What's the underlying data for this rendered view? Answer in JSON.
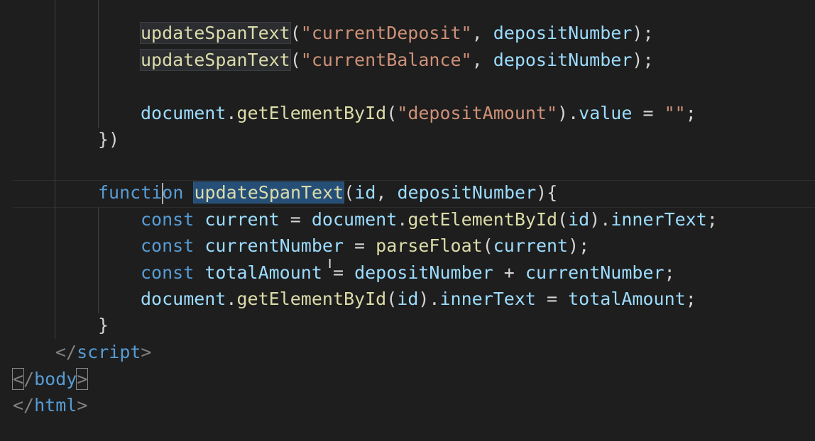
{
  "editor": {
    "theme": "dark",
    "background": "#1e1e1e",
    "colors": {
      "function": "#dcdcaa",
      "variable": "#9cdcfe",
      "string": "#ce9178",
      "keyword": "#569cd6",
      "punctuation": "#d4d4d4",
      "tag_bracket": "#808080"
    },
    "lines": [
      {
        "tokens": [
          {
            "t": "updateSpanText",
            "k": "fn hl"
          },
          {
            "t": "(",
            "k": "punc"
          },
          {
            "t": "\"currentDeposit\"",
            "k": "str"
          },
          {
            "t": ", ",
            "k": "punc"
          },
          {
            "t": "depositNumber",
            "k": "var"
          },
          {
            "t": ");",
            "k": "punc"
          }
        ]
      },
      {
        "tokens": [
          {
            "t": "updateSpanText",
            "k": "fn hl"
          },
          {
            "t": "(",
            "k": "punc"
          },
          {
            "t": "\"currentBalance\"",
            "k": "str"
          },
          {
            "t": ", ",
            "k": "punc"
          },
          {
            "t": "depositNumber",
            "k": "var"
          },
          {
            "t": ");",
            "k": "punc"
          }
        ]
      },
      {
        "tokens": []
      },
      {
        "tokens": [
          {
            "t": "document",
            "k": "var"
          },
          {
            "t": ".",
            "k": "punc"
          },
          {
            "t": "getElementById",
            "k": "fn"
          },
          {
            "t": "(",
            "k": "punc"
          },
          {
            "t": "\"depositAmount\"",
            "k": "str"
          },
          {
            "t": ").",
            "k": "punc"
          },
          {
            "t": "value",
            "k": "var"
          },
          {
            "t": " = ",
            "k": "punc"
          },
          {
            "t": "\"\"",
            "k": "str"
          },
          {
            "t": ";",
            "k": "punc"
          }
        ]
      },
      {
        "tokens": [
          {
            "t": "})",
            "k": "punc"
          }
        ]
      },
      {
        "tokens": []
      },
      {
        "tokens": [
          {
            "t": "function",
            "k": "kw"
          },
          {
            "t": " ",
            "k": "punc"
          },
          {
            "t": "updateSpanText",
            "k": "fn sel"
          },
          {
            "t": "(",
            "k": "punc"
          },
          {
            "t": "id",
            "k": "var"
          },
          {
            "t": ", ",
            "k": "punc"
          },
          {
            "t": "depositNumber",
            "k": "var"
          },
          {
            "t": "){",
            "k": "punc"
          }
        ]
      },
      {
        "tokens": [
          {
            "t": "const",
            "k": "kw"
          },
          {
            "t": " ",
            "k": "punc"
          },
          {
            "t": "current",
            "k": "var"
          },
          {
            "t": " = ",
            "k": "punc"
          },
          {
            "t": "document",
            "k": "var"
          },
          {
            "t": ".",
            "k": "punc"
          },
          {
            "t": "getElementById",
            "k": "fn"
          },
          {
            "t": "(",
            "k": "punc"
          },
          {
            "t": "id",
            "k": "var"
          },
          {
            "t": ").",
            "k": "punc"
          },
          {
            "t": "innerText",
            "k": "var"
          },
          {
            "t": ";",
            "k": "punc"
          }
        ]
      },
      {
        "tokens": [
          {
            "t": "const",
            "k": "kw"
          },
          {
            "t": " ",
            "k": "punc"
          },
          {
            "t": "currentNumber",
            "k": "var"
          },
          {
            "t": " = ",
            "k": "punc"
          },
          {
            "t": "parseFloat",
            "k": "fn"
          },
          {
            "t": "(",
            "k": "punc"
          },
          {
            "t": "current",
            "k": "var"
          },
          {
            "t": ");",
            "k": "punc"
          }
        ]
      },
      {
        "tokens": [
          {
            "t": "const",
            "k": "kw"
          },
          {
            "t": " ",
            "k": "punc"
          },
          {
            "t": "totalAmount",
            "k": "var"
          },
          {
            "t": " = ",
            "k": "punc"
          },
          {
            "t": "depositNumber",
            "k": "var"
          },
          {
            "t": " + ",
            "k": "punc"
          },
          {
            "t": "currentNumber",
            "k": "var"
          },
          {
            "t": ";",
            "k": "punc"
          }
        ]
      },
      {
        "tokens": [
          {
            "t": "document",
            "k": "var"
          },
          {
            "t": ".",
            "k": "punc"
          },
          {
            "t": "getElementById",
            "k": "fn"
          },
          {
            "t": "(",
            "k": "punc"
          },
          {
            "t": "id",
            "k": "var"
          },
          {
            "t": ").",
            "k": "punc"
          },
          {
            "t": "innerText",
            "k": "var"
          },
          {
            "t": " = ",
            "k": "punc"
          },
          {
            "t": "totalAmount",
            "k": "var"
          },
          {
            "t": ";",
            "k": "punc"
          }
        ]
      },
      {
        "tokens": [
          {
            "t": "}",
            "k": "punc"
          }
        ]
      },
      {
        "tokens": [
          {
            "t": "</",
            "k": "gray"
          },
          {
            "t": "script",
            "k": "tag"
          },
          {
            "t": ">",
            "k": "gray"
          }
        ]
      },
      {
        "tokens": [
          {
            "t": "<",
            "k": "gray brk"
          },
          {
            "t": "/",
            "k": "gray"
          },
          {
            "t": "body",
            "k": "tag"
          },
          {
            "t": ">",
            "k": "gray brk"
          }
        ]
      },
      {
        "tokens": [
          {
            "t": "</",
            "k": "gray"
          },
          {
            "t": "html",
            "k": "tag"
          },
          {
            "t": ">",
            "k": "gray"
          }
        ]
      }
    ]
  }
}
